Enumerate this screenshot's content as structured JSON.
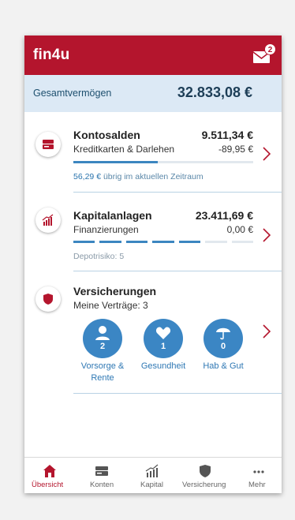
{
  "app": {
    "title": "fin4u",
    "message_count": "2"
  },
  "total": {
    "label": "Gesamtvermögen",
    "value": "32.833,08 €"
  },
  "kontosalden": {
    "title": "Kontosalden",
    "amount": "9.511,34 €",
    "sub": "Kreditkarten & Darlehen",
    "sub_amount": "-89,95 €",
    "progress_fraction": 0.47,
    "note_highlight": "56,29 €",
    "note_rest": " übrig im aktuellen Zeitraum",
    "icon": "credit-card-icon"
  },
  "kapital": {
    "title": "Kapitalanlagen",
    "amount": "23.411,69 €",
    "sub": "Finanzierungen",
    "sub_amount": "0,00 €",
    "risk_level": 5,
    "risk_max": 7,
    "note": "Depotrisiko: 5",
    "icon": "chart-growth-icon"
  },
  "versicherungen": {
    "title": "Versicherungen",
    "sub": "Meine Verträge: 3",
    "icon": "shield-icon",
    "items": [
      {
        "label1": "Vorsorge &",
        "label2": "Rente",
        "count": "2",
        "icon": "person-icon"
      },
      {
        "label1": "Gesundheit",
        "label2": "",
        "count": "1",
        "icon": "heart-icon"
      },
      {
        "label1": "Hab & Gut",
        "label2": "",
        "count": "0",
        "icon": "umbrella-icon"
      }
    ]
  },
  "tabs": [
    {
      "label": "Übersicht",
      "icon": "home-icon",
      "active": true
    },
    {
      "label": "Konten",
      "icon": "card-icon",
      "active": false
    },
    {
      "label": "Kapital",
      "icon": "chart-icon",
      "active": false
    },
    {
      "label": "Versicherung",
      "icon": "shield-icon",
      "active": false
    },
    {
      "label": "Mehr",
      "icon": "more-icon",
      "active": false
    }
  ],
  "colors": {
    "brand": "#b4152d",
    "accent": "#3b86c4",
    "total_bg": "#dce9f5"
  }
}
